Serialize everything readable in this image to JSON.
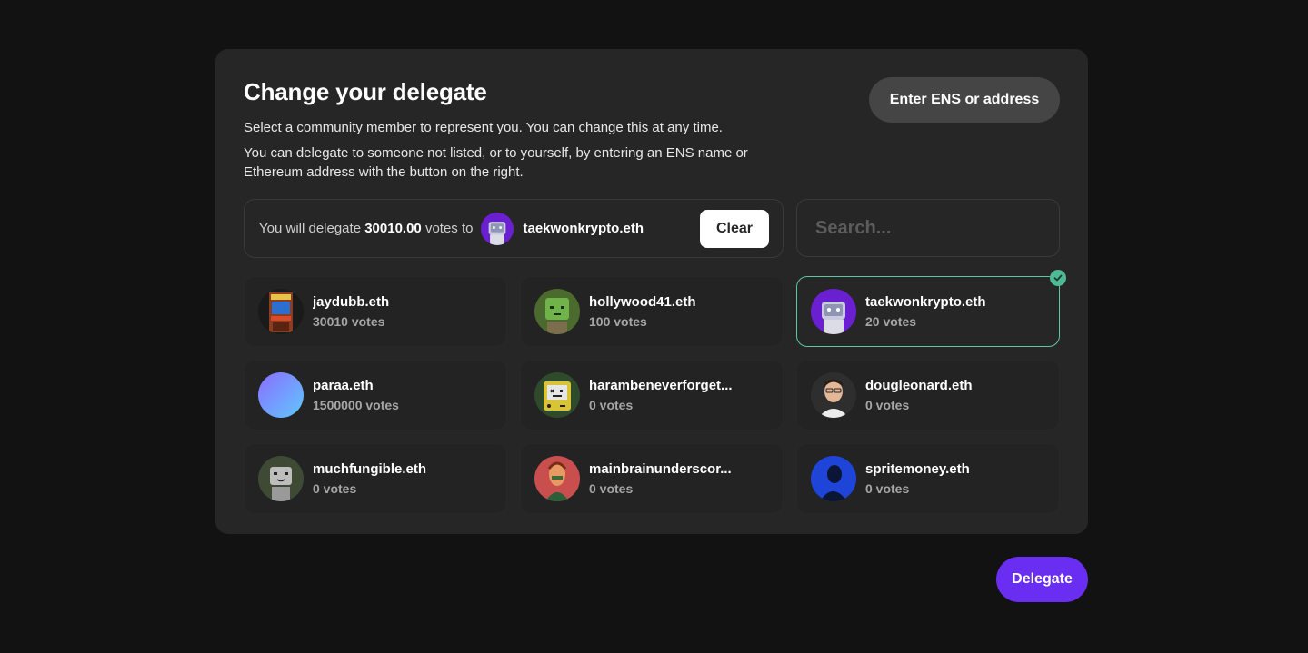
{
  "modal": {
    "title": "Change your delegate",
    "description_1": "Select a community member to represent you. You can change this at any time.",
    "description_2": "You can delegate to someone not listed, or to yourself, by entering an ENS name or Ethereum address with the button on the right.",
    "ens_button": "Enter ENS or address"
  },
  "summary": {
    "prefix": "You will delegate ",
    "amount": "30010.00",
    "suffix": " votes to",
    "target": "taekwonkrypto.eth",
    "clear_label": "Clear"
  },
  "search": {
    "placeholder": "Search..."
  },
  "delegates": [
    {
      "name": "jaydubb.eth",
      "votes": "30010 votes",
      "avatar": "arcade-cabinet-avatar",
      "color": "#8a3d1f"
    },
    {
      "name": "hollywood41.eth",
      "votes": "100 votes",
      "avatar": "green-robot-avatar",
      "color": "#6aa84f"
    },
    {
      "name": "taekwonkrypto.eth",
      "votes": "20 votes",
      "avatar": "purple-robot-avatar",
      "color": "#6a1fd1",
      "selected": true
    },
    {
      "name": "paraa.eth",
      "votes": "1500000 votes",
      "avatar": "gradient-avatar",
      "color": "#7d8cff"
    },
    {
      "name": "harambeneverforget...",
      "votes": "0 votes",
      "avatar": "yellow-robot-avatar",
      "color": "#d9c437"
    },
    {
      "name": "dougleonard.eth",
      "votes": "0 votes",
      "avatar": "person-photo-avatar",
      "color": "#3a3a3a"
    },
    {
      "name": "muchfungible.eth",
      "votes": "0 votes",
      "avatar": "grey-robot-avatar",
      "color": "#6b6b6b"
    },
    {
      "name": "mainbrainunderscor...",
      "votes": "0 votes",
      "avatar": "illustrated-face-avatar",
      "color": "#c94f4f"
    },
    {
      "name": "spritemoney.eth",
      "votes": "0 votes",
      "avatar": "blue-silhouette-avatar",
      "color": "#1f44d8"
    }
  ],
  "delegate_button": "Delegate",
  "colors": {
    "accent": "#6a2ef2",
    "selected_border": "#5cc6a6",
    "check": "#4fb894"
  }
}
